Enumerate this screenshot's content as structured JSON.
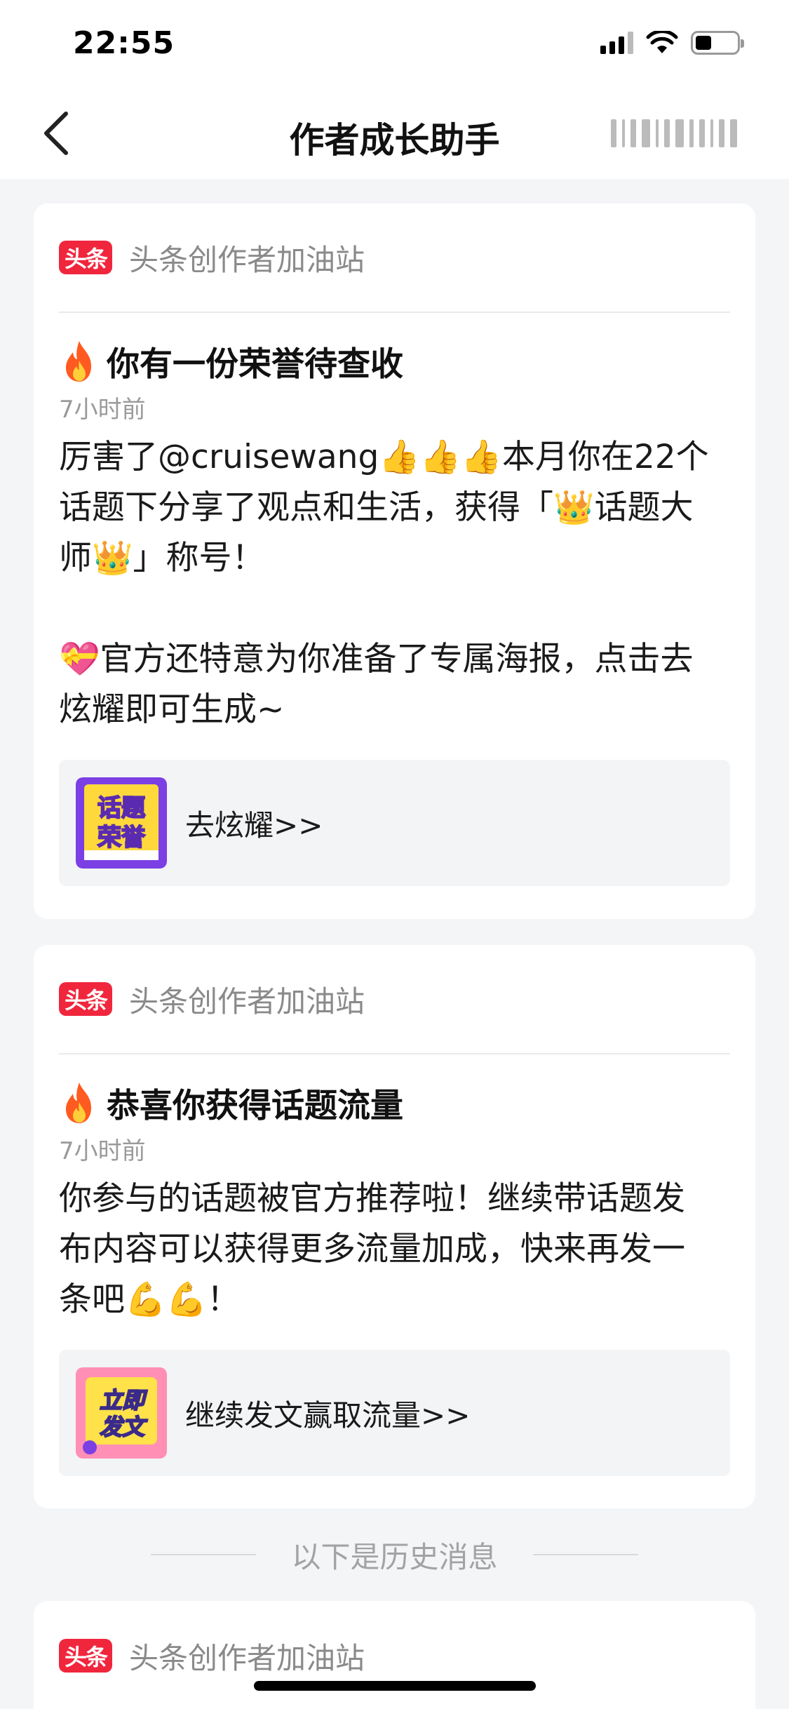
{
  "status_bar": {
    "time": "22:55",
    "icons": [
      "signal-icon",
      "wifi-icon",
      "battery-icon"
    ]
  },
  "nav": {
    "back_icon": "chevron-left-icon",
    "title": "作者成长助手"
  },
  "messages": [
    {
      "sender": "头条创作者加油站",
      "logo_text": "头条",
      "title": "你有一份荣誉待查收",
      "time": "7小时前",
      "body": "厉害了@cruisewang👍👍👍本月你在22个\n话题下分享了观点和生活，获得「👑话题大\n师👑」称号！\n\n💝官方还特意为你准备了专属海报，点击去\n炫耀即可生成~",
      "action_thumb_text": "话题荣誉",
      "action_label": "去炫耀>>"
    },
    {
      "sender": "头条创作者加油站",
      "logo_text": "头条",
      "title": "恭喜你获得话题流量",
      "time": "7小时前",
      "body": "你参与的话题被官方推荐啦！继续带话题发\n布内容可以获得更多流量加成，快来再发一\n条吧💪💪！",
      "action_thumb_text": "立即发文",
      "action_label": "继续发文赢取流量>>"
    },
    {
      "sender": "头条创作者加油站",
      "logo_text": "头条"
    }
  ],
  "history_divider": "以下是历史消息",
  "colors": {
    "brand_red": "#f0263d",
    "background": "#f4f5f7",
    "card": "#ffffff",
    "muted_text": "#8a8a8a"
  }
}
